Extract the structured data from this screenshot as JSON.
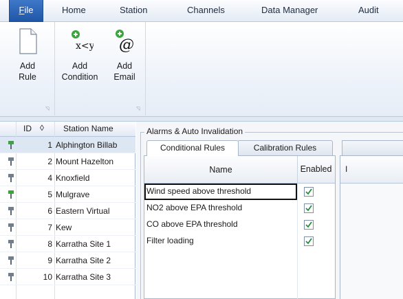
{
  "ribbon_tabs": [
    {
      "label": "File",
      "access_key": "F",
      "rest": "ile"
    },
    {
      "label": "Home"
    },
    {
      "label": "Station"
    },
    {
      "label": "Channels"
    },
    {
      "label": "Data Manager"
    },
    {
      "label": "Audit"
    }
  ],
  "ribbon": {
    "add_rule": {
      "line1": "Add",
      "line2": "Rule"
    },
    "add_condition": {
      "line1": "Add",
      "line2": "Condition"
    },
    "add_email": {
      "line1": "Add",
      "line2": "Email"
    },
    "condition_icon_text": "x<y",
    "email_icon_text": "@"
  },
  "grid": {
    "header": {
      "id": "ID",
      "sort_glyph": "◊",
      "name": "Station Name"
    },
    "rows": [
      {
        "id": "1",
        "name": "Alphington Billab",
        "status": "green"
      },
      {
        "id": "2",
        "name": "Mount Hazelton",
        "status": "grey"
      },
      {
        "id": "4",
        "name": "Knoxfield",
        "status": "grey"
      },
      {
        "id": "5",
        "name": "Mulgrave",
        "status": "green"
      },
      {
        "id": "6",
        "name": "Eastern Virtual",
        "status": "grey"
      },
      {
        "id": "7",
        "name": "Kew",
        "status": "grey"
      },
      {
        "id": "8",
        "name": "Karratha Site 1",
        "status": "grey"
      },
      {
        "id": "9",
        "name": "Karratha Site 2",
        "status": "grey"
      },
      {
        "id": "10",
        "name": "Karratha Site 3",
        "status": "grey"
      }
    ]
  },
  "panel": {
    "group_title": "Alarms & Auto Invalidation",
    "tabs": {
      "conditional": "Conditional Rules",
      "calibration": "Calibration Rules"
    },
    "table": {
      "col_name": "Name",
      "col_enabled": "Enabled",
      "rows": [
        {
          "name": "Wind speed above threshold",
          "enabled": true
        },
        {
          "name": "NO2 above EPA threshold",
          "enabled": true
        },
        {
          "name": "CO above EPA threshold",
          "enabled": true
        },
        {
          "name": "Filter loading",
          "enabled": true
        }
      ]
    },
    "right_header": "I"
  },
  "colors": {
    "accent": "#2a62b8",
    "status_green": "#3aa63a",
    "status_grey": "#6f7f90",
    "check": "#1f8f3a"
  }
}
